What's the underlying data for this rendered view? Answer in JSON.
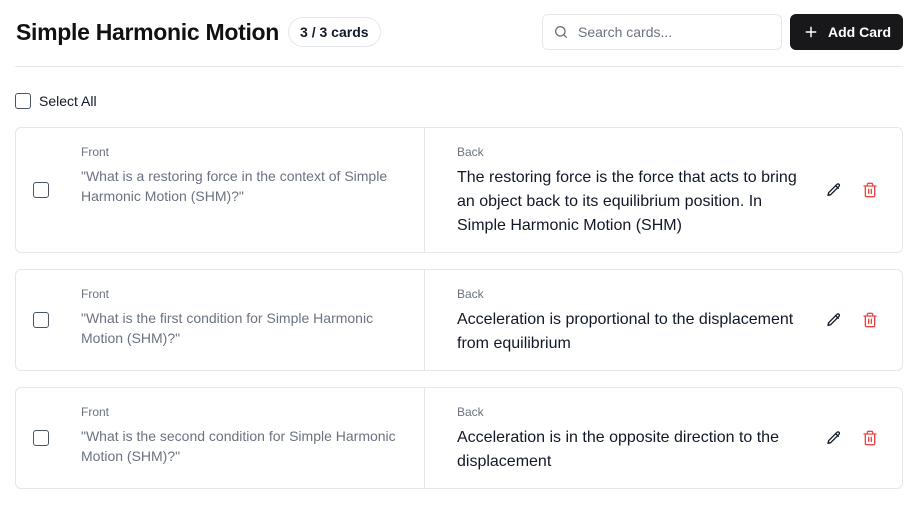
{
  "header": {
    "title": "Simple Harmonic Motion",
    "count_badge": "3 / 3 cards",
    "search_placeholder": "Search cards...",
    "add_button_label": "Add Card"
  },
  "select_all_label": "Select All",
  "cards": [
    {
      "front_label": "Front",
      "front": "\"What is a restoring force in the context of Simple Harmonic Motion (SHM)?\"",
      "back_label": "Back",
      "back": "The restoring force is the force that acts to bring an object back to its equilibrium position. In Simple Harmonic Motion (SHM)"
    },
    {
      "front_label": "Front",
      "front": "\"What is the first condition for Simple Harmonic Motion (SHM)?\"",
      "back_label": "Back",
      "back": "Acceleration is proportional to the displacement from equilibrium"
    },
    {
      "front_label": "Front",
      "front": "\"What is the second condition for Simple Harmonic Motion (SHM)?\"",
      "back_label": "Back",
      "back": "Acceleration is in the opposite direction to the displacement"
    }
  ],
  "colors": {
    "primary_button": "#18181b",
    "delete_icon": "#ef4444",
    "muted_text": "#6b7280",
    "border": "#e5e7eb"
  },
  "icons": {
    "search": "search-icon",
    "add": "plus-icon",
    "edit": "pencil-icon",
    "delete": "trash-icon"
  }
}
